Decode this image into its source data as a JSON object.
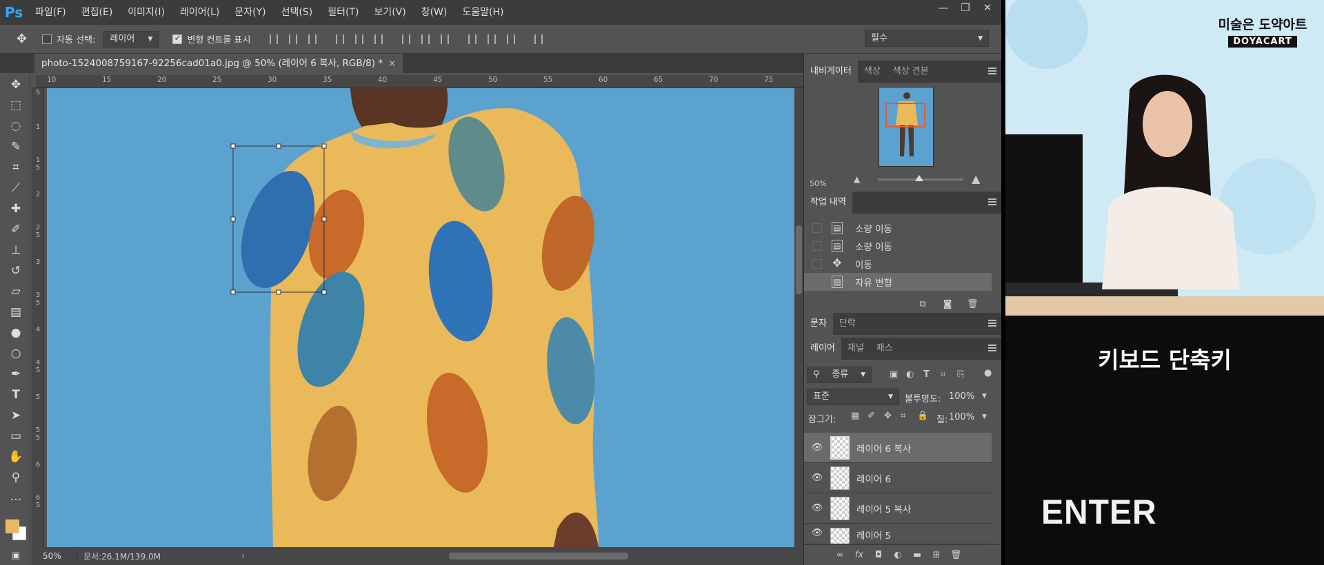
{
  "app": {
    "logo": "Ps"
  },
  "menubar": {
    "items": [
      "파일(F)",
      "편집(E)",
      "이미지(I)",
      "레이어(L)",
      "문자(Y)",
      "선택(S)",
      "필터(T)",
      "보기(V)",
      "창(W)",
      "도움말(H)"
    ],
    "window_controls": [
      "—",
      "❐",
      "✕"
    ]
  },
  "options": {
    "auto_select_label": "자동 선택:",
    "auto_select_value": "레이어",
    "transform_controls_label": "변형 컨트롤 표시",
    "workspace": "필수"
  },
  "document": {
    "tab_title": "photo-1524008759167-92256cad01a0.jpg @ 50% (레이어 6 복사, RGB/8) *",
    "close": "×",
    "ruler_h": [
      "10",
      "15",
      "20",
      "25",
      "30",
      "35",
      "40",
      "45",
      "50",
      "55",
      "60",
      "65",
      "70",
      "75"
    ],
    "ruler_v": [
      "5",
      "1",
      "1 5",
      "2",
      "2 5",
      "3",
      "3 5",
      "4",
      "4 5",
      "5",
      "5 5",
      "6",
      "6 5"
    ]
  },
  "status": {
    "zoom": "50%",
    "doc_info": "문서:26.1M/139.0M"
  },
  "navigator": {
    "tabs": [
      "내비게이터",
      "색상",
      "색상 견본"
    ],
    "zoom": "50%"
  },
  "history": {
    "tab": "작업 내역",
    "items": [
      "소량 이동",
      "소량 이동",
      "이동",
      "자유 변형"
    ]
  },
  "char_panel": {
    "tabs": [
      "문자",
      "단락"
    ]
  },
  "layers_panel": {
    "tabs": [
      "레이어",
      "채널",
      "패스"
    ],
    "filter": "종류",
    "blend_mode": "표준",
    "opacity_label": "불투명도:",
    "opacity_value": "100%",
    "lock_label": "잠그기:",
    "fill_label": "칠:",
    "fill_value": "100%",
    "layers": [
      "레이어 6 복사",
      "레이어 6",
      "레이어 5 복사",
      "레이어 5"
    ]
  },
  "video": {
    "brand_title": "미술은 도약아트",
    "brand_sub": "DOYACART",
    "shortcut_title": "키보드 단축키",
    "shortcut_key": "ENTER"
  },
  "colors": {
    "canvas_bg": "#5ca2cf",
    "shirt": "#eab95a",
    "foreground": "#e9b960",
    "background": "#ffffff",
    "accent": "#31a8ff"
  }
}
